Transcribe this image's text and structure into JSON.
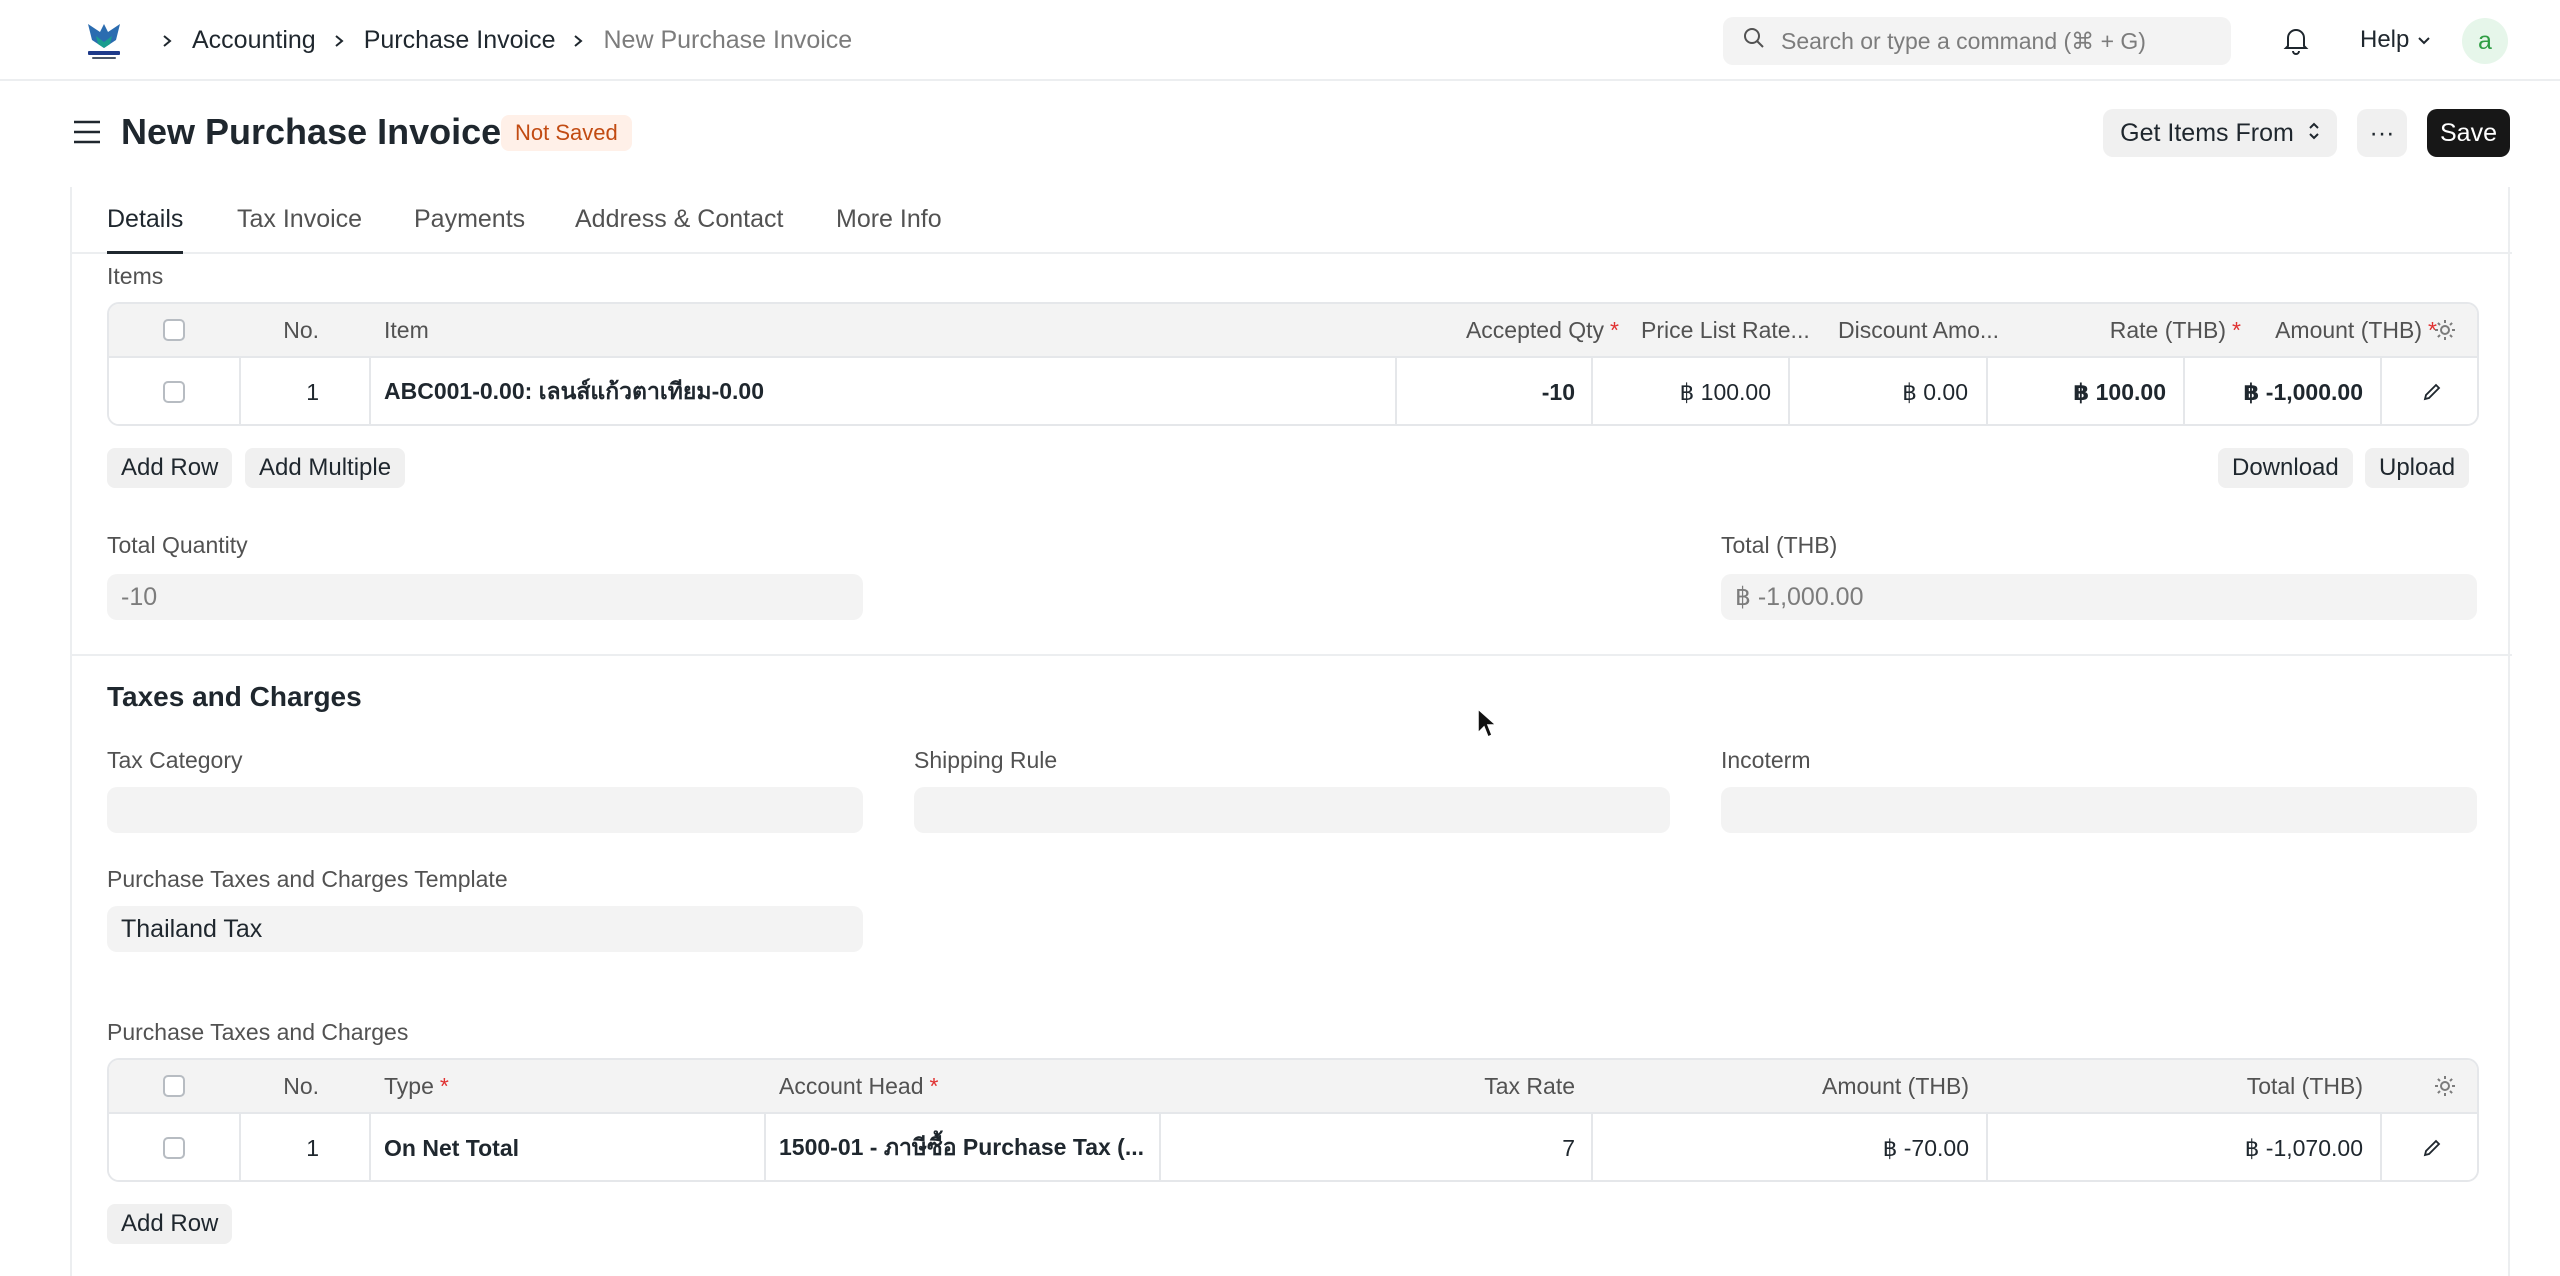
{
  "breadcrumbs": [
    "Accounting",
    "Purchase Invoice",
    "New Purchase Invoice"
  ],
  "search": {
    "placeholder": "Search or type a command (⌘ + G)"
  },
  "navbar": {
    "help_label": "Help",
    "avatar_letter": "a"
  },
  "header": {
    "title": "New Purchase Invoice",
    "status": "Not Saved",
    "get_items_label": "Get Items From",
    "more_label": "···",
    "save_label": "Save"
  },
  "tabs": [
    "Details",
    "Tax Invoice",
    "Payments",
    "Address & Contact",
    "More Info"
  ],
  "items": {
    "section_label": "Items",
    "columns": {
      "no": "No.",
      "item": "Item",
      "accepted_qty": "Accepted Qty",
      "price_list_rate": "Price List Rate...",
      "discount": "Discount Amo...",
      "rate": "Rate (THB)",
      "amount": "Amount (THB)"
    },
    "rows": [
      {
        "no": "1",
        "item": "ABC001-0.00: เลนส์แก้วตาเทียม-0.00",
        "accepted_qty": "-10",
        "price_list_rate": "฿ 100.00",
        "discount": "฿ 0.00",
        "rate": "฿ 100.00",
        "amount": "฿ -1,000.00"
      }
    ],
    "add_row_label": "Add Row",
    "add_multiple_label": "Add Multiple",
    "download_label": "Download",
    "upload_label": "Upload"
  },
  "totals": {
    "total_quantity_label": "Total Quantity",
    "total_quantity_value": "-10",
    "total_label": "Total (THB)",
    "total_value": "฿ -1,000.00"
  },
  "taxes": {
    "section_title": "Taxes and Charges",
    "tax_category_label": "Tax Category",
    "tax_category_value": "",
    "shipping_rule_label": "Shipping Rule",
    "shipping_rule_value": "",
    "incoterm_label": "Incoterm",
    "incoterm_value": "",
    "template_label": "Purchase Taxes and Charges Template",
    "template_value": "Thailand Tax",
    "table_label": "Purchase Taxes and Charges",
    "columns": {
      "no": "No.",
      "type": "Type",
      "account_head": "Account Head",
      "tax_rate": "Tax Rate",
      "amount": "Amount (THB)",
      "total": "Total (THB)"
    },
    "rows": [
      {
        "no": "1",
        "type": "On Net Total",
        "account_head": "1500-01 - ภาษีซื้อ Purchase Tax (...",
        "tax_rate": "7",
        "amount": "฿ -70.00",
        "total": "฿ -1,070.00"
      }
    ],
    "add_row_label": "Add Row"
  },
  "colors": {
    "accent": "#171717",
    "status_bg": "#fff0e8",
    "status_fg": "#c24b12",
    "required": "#e03131"
  }
}
